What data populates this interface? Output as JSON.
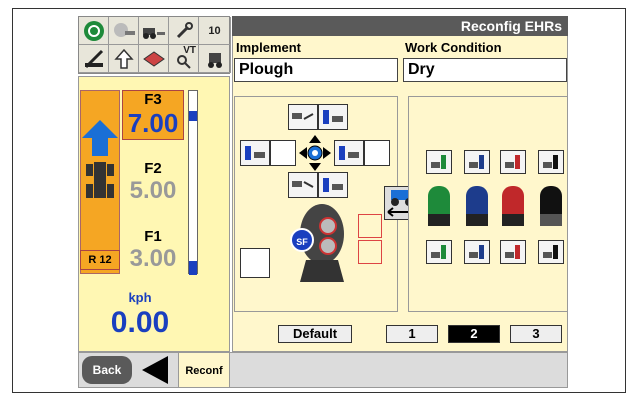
{
  "window": {
    "title": "Reconfig EHRs"
  },
  "fields": {
    "implement_label": "Implement",
    "implement_value": "Plough",
    "work_condition_label": "Work Condition",
    "work_condition_value": "Dry"
  },
  "topbar": {
    "badge_10": "10",
    "badge_vt": "VT"
  },
  "gears": [
    {
      "label": "F3",
      "value": "7.00",
      "active": true
    },
    {
      "label": "F2",
      "value": "5.00",
      "active": false
    },
    {
      "label": "F1",
      "value": "3.00",
      "active": false
    }
  ],
  "range": "R 12",
  "speed": {
    "unit": "kph",
    "value": "0.00"
  },
  "buttons": {
    "default": "Default",
    "back": "Back",
    "reconf": "Reconf",
    "sf": "SF"
  },
  "pages": [
    "1",
    "2",
    "3"
  ],
  "selected_page": "2",
  "valve_colors": [
    "#1e8a3a",
    "#1d3c8c",
    "#c0282a",
    "#111111"
  ],
  "colors": {
    "accent": "#1a3fbf",
    "orange": "#f5a623",
    "panel": "#fff7cc"
  }
}
